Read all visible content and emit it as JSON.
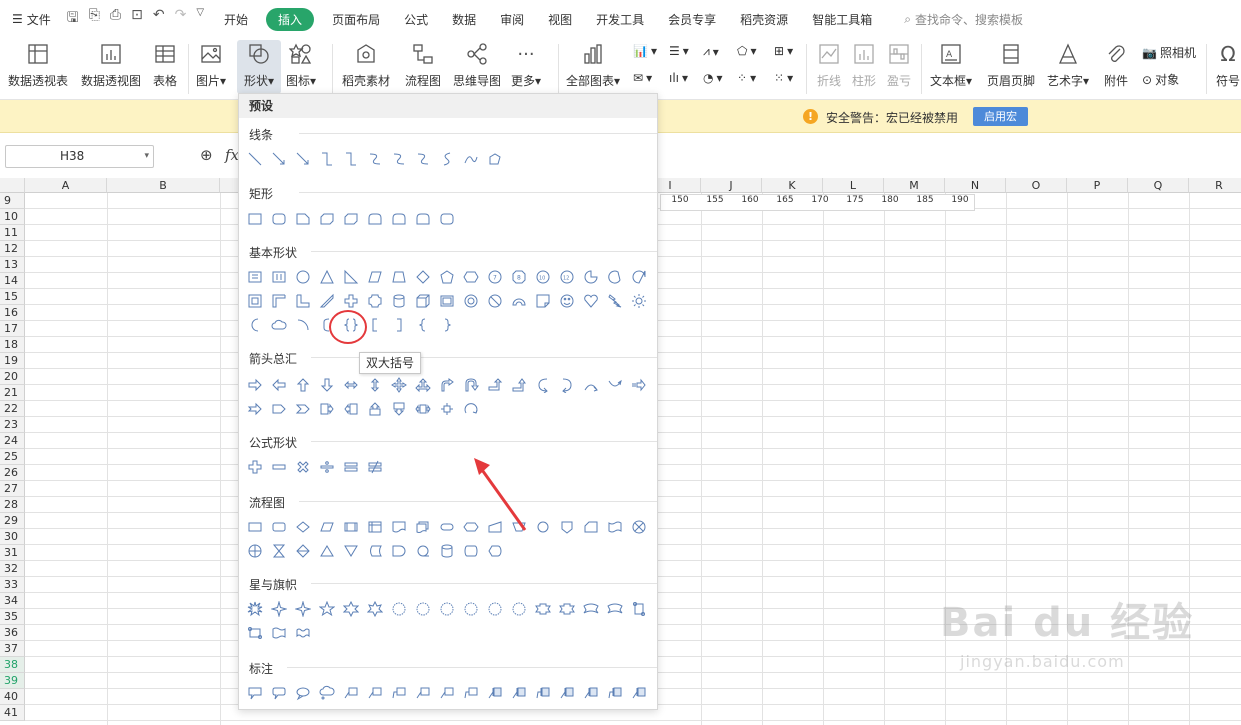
{
  "menubar": {
    "file": "文件",
    "tabs": [
      "开始",
      "插入",
      "页面布局",
      "公式",
      "数据",
      "审阅",
      "视图",
      "开发工具",
      "会员专享",
      "稻壳资源",
      "智能工具箱"
    ],
    "active_tab": "插入",
    "search": "查找命令、搜索模板"
  },
  "ribbon": {
    "pivot_table": "数据透视表",
    "pivot_chart": "数据透视图",
    "table": "表格",
    "picture": "图片",
    "shape": "形状",
    "icon": "图标",
    "docer": "稻壳素材",
    "flowchart": "流程图",
    "mindmap": "思维导图",
    "more": "更多",
    "all_charts": "全部图表",
    "spark_line": "折线",
    "spark_column": "柱形",
    "spark_winloss": "盈亏",
    "textbox": "文本框",
    "header_footer": "页眉页脚",
    "wordart": "艺术字",
    "attachment": "附件",
    "camera": "照相机",
    "object": "对象",
    "symbol": "符号"
  },
  "warning": {
    "icon": "!",
    "text": "安全警告：宏已经被禁用",
    "button": "启用宏"
  },
  "formula": {
    "namebox": "H38",
    "fx": "fx"
  },
  "grid": {
    "columns": [
      "A",
      "B",
      "I",
      "J",
      "K",
      "L",
      "M",
      "N",
      "O",
      "P",
      "Q",
      "R"
    ],
    "rows": [
      "9",
      "10",
      "11",
      "12",
      "13",
      "14",
      "15",
      "16",
      "17",
      "18",
      "19",
      "20",
      "21",
      "22",
      "23",
      "24",
      "25",
      "26",
      "27",
      "28",
      "29",
      "30",
      "31",
      "32",
      "33",
      "34",
      "35",
      "36",
      "37",
      "38",
      "39",
      "40",
      "41"
    ],
    "selected_rows": [
      "38",
      "39"
    ],
    "row9_values": [
      "150",
      "155",
      "160",
      "165",
      "170",
      "175",
      "180",
      "185",
      "190"
    ]
  },
  "shapes_panel": {
    "header": "预设",
    "categories": {
      "lines": "线条",
      "rect": "矩形",
      "basic": "基本形状",
      "arrows": "箭头总汇",
      "equation": "公式形状",
      "flow": "流程图",
      "stars": "星与旗帜",
      "callouts": "标注"
    },
    "tooltip": "双大括号"
  },
  "watermark": {
    "main": "Bai du 经验",
    "sub": "jingyan.baidu.com"
  },
  "colors": {
    "accent": "#28a56a",
    "highlight": "#e4393c",
    "shape_stroke": "#5b7fb5",
    "warn_bg": "#fdf3c4"
  }
}
